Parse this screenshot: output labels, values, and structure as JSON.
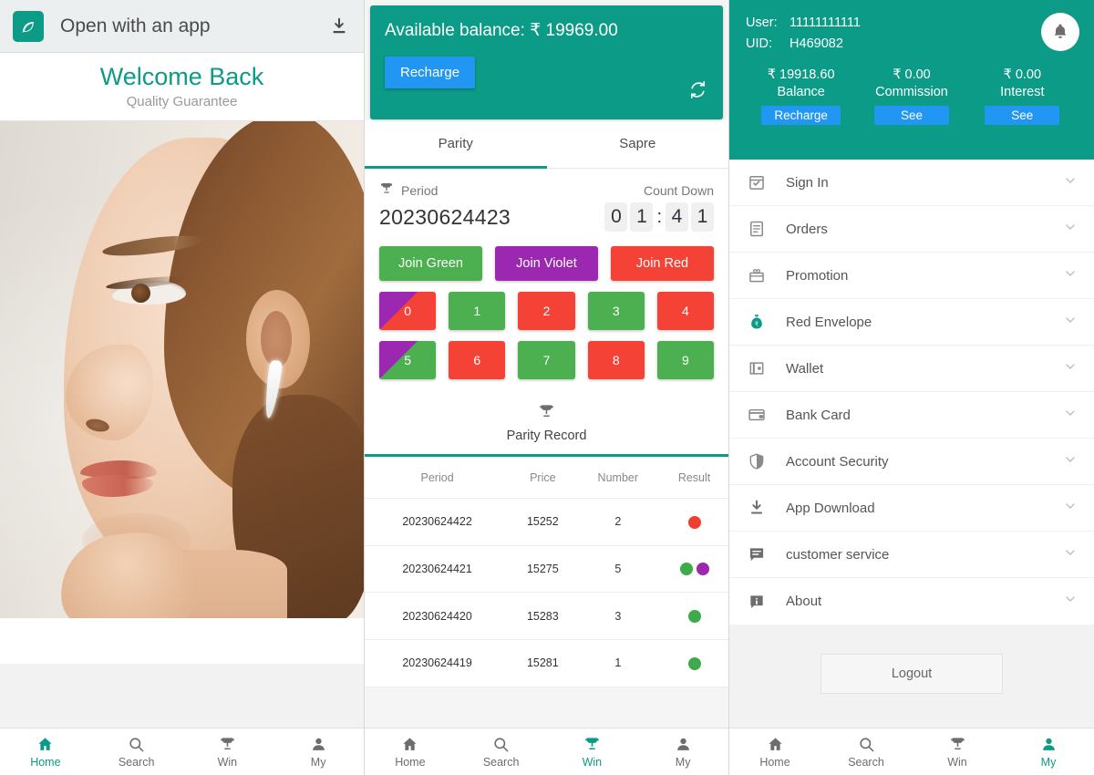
{
  "left": {
    "open_bar": {
      "label": "Open with an app",
      "app_icon": "leaf-app-icon",
      "download_icon": "download-icon"
    },
    "welcome": {
      "title": "Welcome Back",
      "subtitle": "Quality Guarantee"
    },
    "hero_alt": "woman-profile-photo"
  },
  "middle": {
    "balance": {
      "text": "Available balance: ₹ 19969.00",
      "recharge_label": "Recharge",
      "refresh_icon": "refresh-icon"
    },
    "tabs": [
      {
        "label": "Parity",
        "active": true
      },
      {
        "label": "Sapre",
        "active": false
      }
    ],
    "period": {
      "icon": "trophy-icon",
      "label": "Period",
      "value": "20230624423",
      "countdown_label": "Count Down",
      "countdown_digits": [
        "0",
        "1",
        "4",
        "1"
      ],
      "countdown_value": "01:41"
    },
    "join_buttons": [
      {
        "label": "Join Green",
        "color": "#4caf50"
      },
      {
        "label": "Join Violet",
        "color": "#9c27b0"
      },
      {
        "label": "Join Red",
        "color": "#f44336"
      }
    ],
    "numbers": [
      {
        "label": "0",
        "color": "#f44336",
        "corner": "#9c27b0"
      },
      {
        "label": "1",
        "color": "#4caf50",
        "corner": null
      },
      {
        "label": "2",
        "color": "#f44336",
        "corner": null
      },
      {
        "label": "3",
        "color": "#4caf50",
        "corner": null
      },
      {
        "label": "4",
        "color": "#f44336",
        "corner": null
      },
      {
        "label": "5",
        "color": "#4caf50",
        "corner": "#9c27b0"
      },
      {
        "label": "6",
        "color": "#f44336",
        "corner": null
      },
      {
        "label": "7",
        "color": "#4caf50",
        "corner": null
      },
      {
        "label": "8",
        "color": "#f44336",
        "corner": null
      },
      {
        "label": "9",
        "color": "#4caf50",
        "corner": null
      }
    ],
    "record": {
      "icon": "trophy-icon",
      "title": "Parity Record",
      "columns": [
        "Period",
        "Price",
        "Number",
        "Result"
      ],
      "rows": [
        {
          "period": "20230624422",
          "price": "15252",
          "number": "2",
          "number_color": "red",
          "dots": [
            "red"
          ]
        },
        {
          "period": "20230624421",
          "price": "15275",
          "number": "5",
          "number_color": "green",
          "dots": [
            "green",
            "violet"
          ]
        },
        {
          "period": "20230624420",
          "price": "15283",
          "number": "3",
          "number_color": "green",
          "dots": [
            "green"
          ]
        },
        {
          "period": "20230624419",
          "price": "15281",
          "number": "1",
          "number_color": "green",
          "dots": [
            "green"
          ]
        }
      ]
    }
  },
  "right": {
    "account": {
      "user_key": "User:",
      "user_value": "11111111111",
      "uid_key": "UID:",
      "uid_value": "H469082",
      "bell_icon": "bell-icon",
      "stats": [
        {
          "value": "₹ 19918.60",
          "label": "Balance",
          "button": "Recharge"
        },
        {
          "value": "₹ 0.00",
          "label": "Commission",
          "button": "See"
        },
        {
          "value": "₹ 0.00",
          "label": "Interest",
          "button": "See"
        }
      ]
    },
    "menu": [
      {
        "label": "Sign In",
        "icon": "calendar-check-icon"
      },
      {
        "label": "Orders",
        "icon": "list-document-icon"
      },
      {
        "label": "Promotion",
        "icon": "gift-icon"
      },
      {
        "label": "Red Envelope",
        "icon": "money-bag-icon",
        "accent": "#0c9b87"
      },
      {
        "label": "Wallet",
        "icon": "wallet-icon"
      },
      {
        "label": "Bank Card",
        "icon": "credit-card-icon"
      },
      {
        "label": "Account Security",
        "icon": "shield-icon"
      },
      {
        "label": "App Download",
        "icon": "download-icon"
      },
      {
        "label": "customer service",
        "icon": "chat-icon"
      },
      {
        "label": "About",
        "icon": "info-icon"
      }
    ],
    "chevron_icon": "chevron-down-icon",
    "logout_label": "Logout"
  },
  "bottom_nav": {
    "items": [
      {
        "label": "Home",
        "icon": "home-icon"
      },
      {
        "label": "Search",
        "icon": "search-icon"
      },
      {
        "label": "Win",
        "icon": "trophy-icon"
      },
      {
        "label": "My",
        "icon": "person-icon"
      }
    ],
    "active": {
      "left": "Home",
      "middle": "Win",
      "right": "My"
    }
  },
  "colors": {
    "teal": "#0c9b87",
    "blue": "#2196f3",
    "green": "#4caf50",
    "red": "#f44336",
    "violet": "#9c27b0"
  }
}
